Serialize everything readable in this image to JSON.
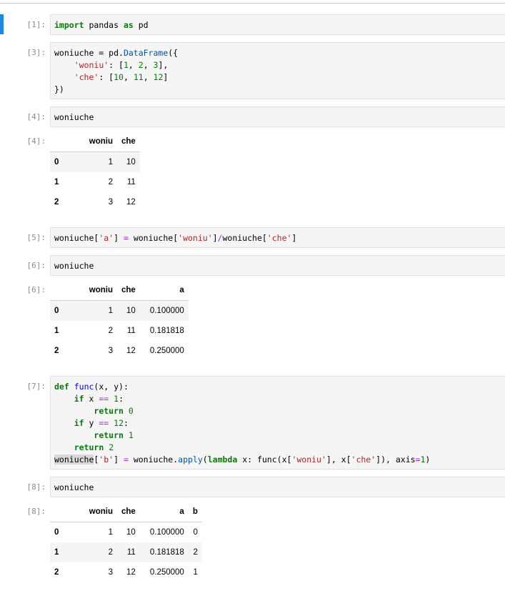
{
  "cells": [
    {
      "prompt": "[1]:",
      "code": [
        "import pandas as pd"
      ]
    },
    {
      "prompt": "[3]:",
      "code": [
        "woniuche = pd.DataFrame({",
        "    'woniu': [1, 2, 3],",
        "    'che': [10, 11, 12]",
        "})"
      ]
    },
    {
      "prompt": "[4]:",
      "code": [
        "woniuche"
      ],
      "out_prompt": "[4]:",
      "table": {
        "columns": [
          "woniu",
          "che"
        ],
        "rows": [
          [
            "0",
            "1",
            "10"
          ],
          [
            "1",
            "2",
            "11"
          ],
          [
            "2",
            "3",
            "12"
          ]
        ]
      }
    },
    {
      "prompt": "[5]:",
      "code": [
        "woniuche['a'] = woniuche['woniu']/woniuche['che']"
      ]
    },
    {
      "prompt": "[6]:",
      "code": [
        "woniuche"
      ],
      "out_prompt": "[6]:",
      "table": {
        "columns": [
          "woniu",
          "che",
          "a"
        ],
        "rows": [
          [
            "0",
            "1",
            "10",
            "0.100000"
          ],
          [
            "1",
            "2",
            "11",
            "0.181818"
          ],
          [
            "2",
            "3",
            "12",
            "0.250000"
          ]
        ]
      }
    },
    {
      "prompt": "[7]:",
      "code": [
        "def func(x, y):",
        "    if x == 1:",
        "        return 0",
        "    if y == 12:",
        "        return 1",
        "    return 2",
        "woniuche['b'] = woniuche.apply(lambda x: func(x['woniu'], x['che']), axis=1)"
      ]
    },
    {
      "prompt": "[8]:",
      "code": [
        "woniuche"
      ],
      "out_prompt": "[8]:",
      "table": {
        "columns": [
          "woniu",
          "che",
          "a",
          "b"
        ],
        "rows": [
          [
            "0",
            "1",
            "10",
            "0.100000",
            "0"
          ],
          [
            "1",
            "2",
            "11",
            "0.181818",
            "2"
          ],
          [
            "2",
            "3",
            "12",
            "0.250000",
            "1"
          ]
        ]
      }
    }
  ],
  "colors": {
    "active_cell": "#1e88e5",
    "keyword": "#008000",
    "string": "#ba2121"
  }
}
